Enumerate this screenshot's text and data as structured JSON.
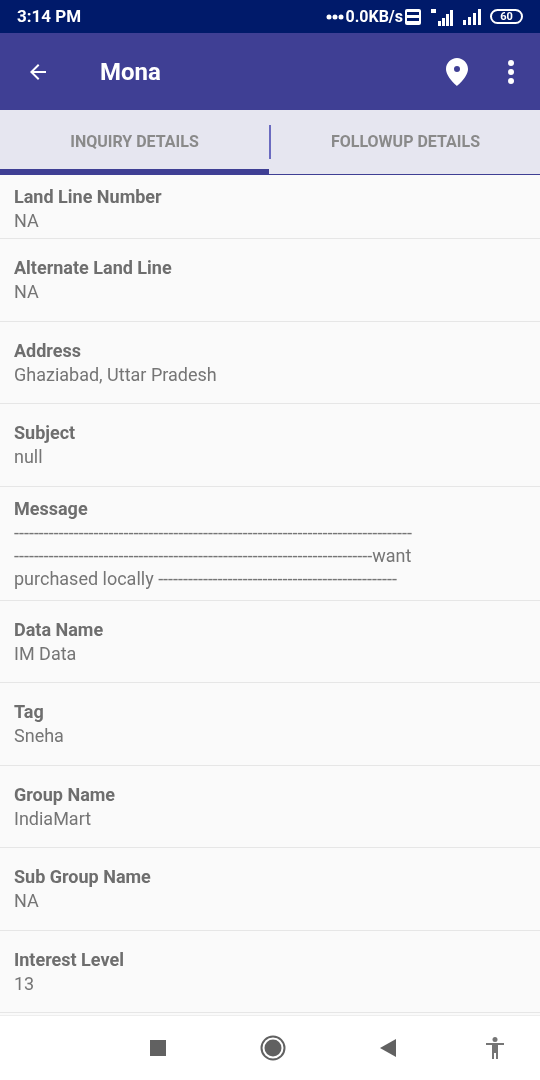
{
  "status_bar": {
    "time": "3:14 PM",
    "speed": "0.0KB/s",
    "battery": "60"
  },
  "app_bar": {
    "title": "Mona"
  },
  "tabs": [
    {
      "label": "INQUIRY DETAILS",
      "selected": true
    },
    {
      "label": "FOLLOWUP DETAILS",
      "selected": false
    }
  ],
  "fields": [
    {
      "label": "Land Line Number",
      "value": "NA"
    },
    {
      "label": "Alternate Land Line",
      "value": "NA"
    },
    {
      "label": "Address",
      "value": "Ghaziabad, Uttar Pradesh"
    },
    {
      "label": "Subject",
      "value": "null"
    },
    {
      "label": "Message",
      "value": "--------------------------------------------------------------------------------\n------------------------------------------------------------------------want\npurchased locally ------------------------------------------------"
    },
    {
      "label": "Data Name",
      "value": "IM Data"
    },
    {
      "label": "Tag",
      "value": "Sneha"
    },
    {
      "label": "Group Name",
      "value": "IndiaMart"
    },
    {
      "label": "Sub Group Name",
      "value": "NA"
    },
    {
      "label": "Interest Level",
      "value": "13"
    }
  ]
}
